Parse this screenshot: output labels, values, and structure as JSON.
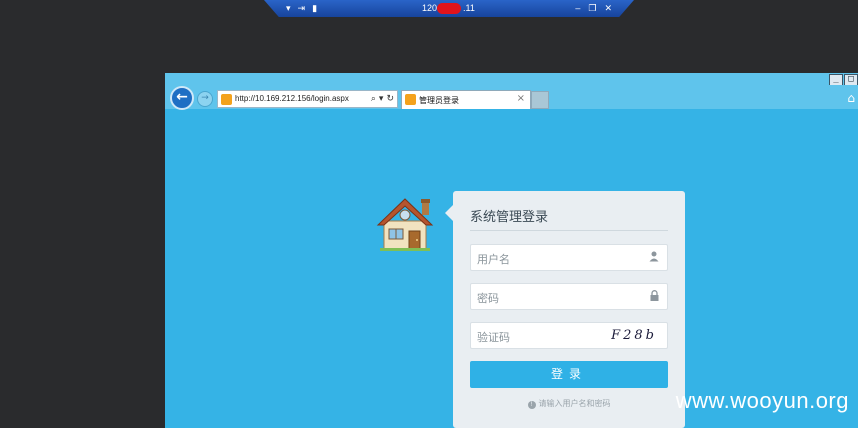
{
  "rdp_bar": {
    "title_start": "120.",
    "title_end": ".11",
    "icons": [
      "pin-icon",
      "signal-icon",
      "minimize-icon",
      "restore-icon",
      "close-icon"
    ]
  },
  "browser": {
    "address": "http://10.169.212.156/login.aspx",
    "tab_label": "管理员登录",
    "tab_close": "×"
  },
  "login": {
    "title": "系统管理登录",
    "username_placeholder": "用户名",
    "password_placeholder": "密码",
    "captcha_placeholder": "验证码",
    "captcha_text": "F28b",
    "submit_label": "登录",
    "hint": "请输入用户名和密码"
  },
  "watermark": "www.wooyun.org",
  "colors": {
    "page_bg": "#35b3e6",
    "button": "#2fb1e6",
    "panel": "#e9eef2",
    "rdp_bar": "#1f55b4"
  }
}
